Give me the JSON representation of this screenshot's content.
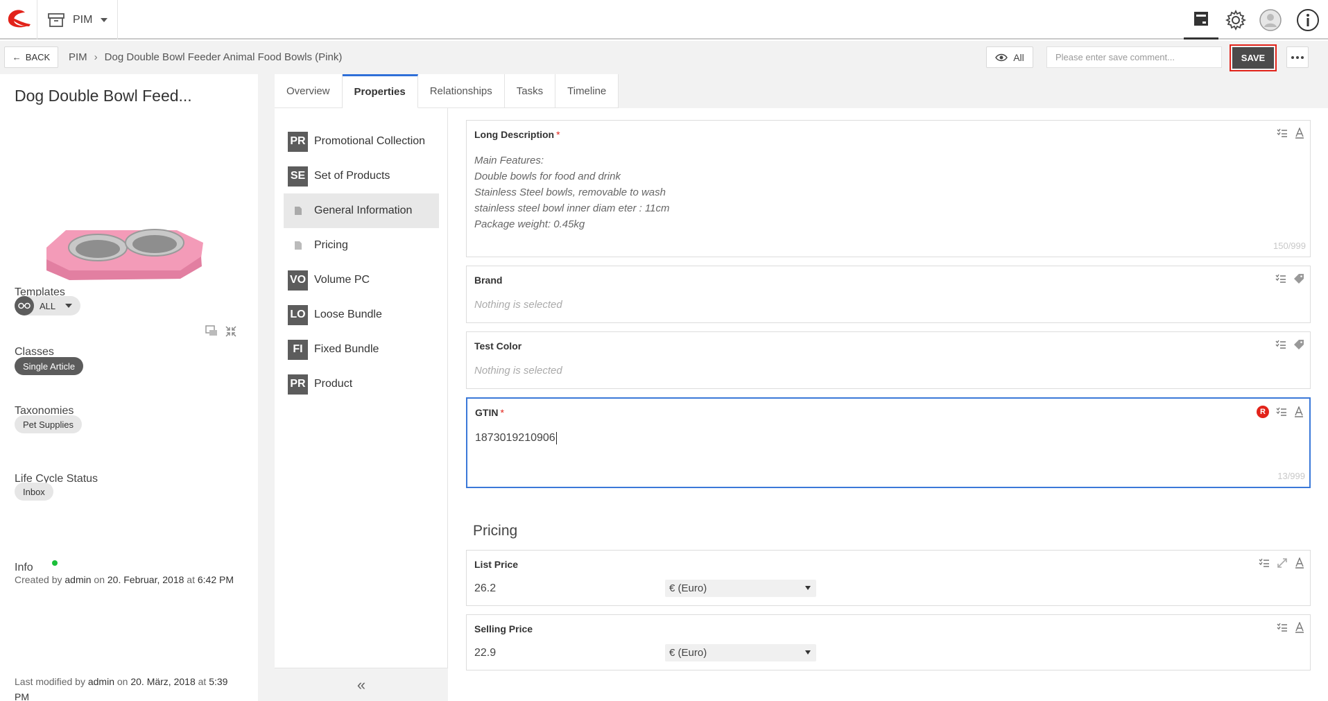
{
  "app": {
    "module_label": "PIM"
  },
  "subbar": {
    "back_label": "BACK",
    "breadcrumb": [
      "PIM",
      "Dog Double Bowl Feeder Animal Food Bowls (Pink)"
    ],
    "view_label": "All",
    "comment_placeholder": "Please enter save comment...",
    "save_label": "SAVE"
  },
  "product": {
    "title": "Dog Double Bowl Feed...",
    "templates_label": "Templates",
    "template_value": "ALL",
    "classes_label": "Classes",
    "class_value": "Single Article",
    "taxonomies_label": "Taxonomies",
    "taxonomy_value": "Pet Supplies",
    "lifecycle_label": "Life Cycle Status",
    "lifecycle_value": "Inbox",
    "info_label": "Info",
    "created_prefix": "Created by",
    "created_by": "admin",
    "created_on_word": "on",
    "created_date": "20. Februar, 2018",
    "created_at_word": "at",
    "created_time": "6:42 PM",
    "modified_prefix": "Last modified by",
    "modified_by": "admin",
    "modified_on_word": "on",
    "modified_date": "20. März, 2018",
    "modified_at_word": "at",
    "modified_time": "5:39 PM"
  },
  "tabs": [
    "Overview",
    "Properties",
    "Relationships",
    "Tasks",
    "Timeline"
  ],
  "class_list": [
    {
      "badge": "PR",
      "label": "Promotional Collection"
    },
    {
      "badge": "SE",
      "label": "Set of Products"
    },
    {
      "badge": "",
      "label": "General Information"
    },
    {
      "badge": "",
      "label": "Pricing"
    },
    {
      "badge": "VO",
      "label": "Volume PC"
    },
    {
      "badge": "LO",
      "label": "Loose Bundle"
    },
    {
      "badge": "FI",
      "label": "Fixed Bundle"
    },
    {
      "badge": "PR",
      "label": "Product"
    }
  ],
  "fields": {
    "long_description": {
      "label": "Long Description",
      "lines": [
        "Main Features:",
        "Double bowls for food and drink",
        "Stainless Steel bowls, removable to wash",
        "stainless steel bowl inner diam eter : 11cm",
        "Package weight: 0.45kg"
      ],
      "count": "150/999"
    },
    "brand": {
      "label": "Brand",
      "value": "Nothing is selected"
    },
    "test_color": {
      "label": "Test Color",
      "value": "Nothing is selected"
    },
    "gtin": {
      "label": "GTIN",
      "value": "1873019210906",
      "count": "13/999",
      "badge": "R"
    },
    "pricing_section": "Pricing",
    "list_price": {
      "label": "List Price",
      "value": "26.2",
      "currency": "€ (Euro)"
    },
    "selling_price": {
      "label": "Selling Price",
      "value": "22.9",
      "currency": "€ (Euro)"
    }
  },
  "colors": {
    "accent_blue": "#2e6fd8",
    "save_highlight": "#e2231a",
    "dark_chip": "#5c5c5c",
    "status_green": "#1bbf3a"
  }
}
